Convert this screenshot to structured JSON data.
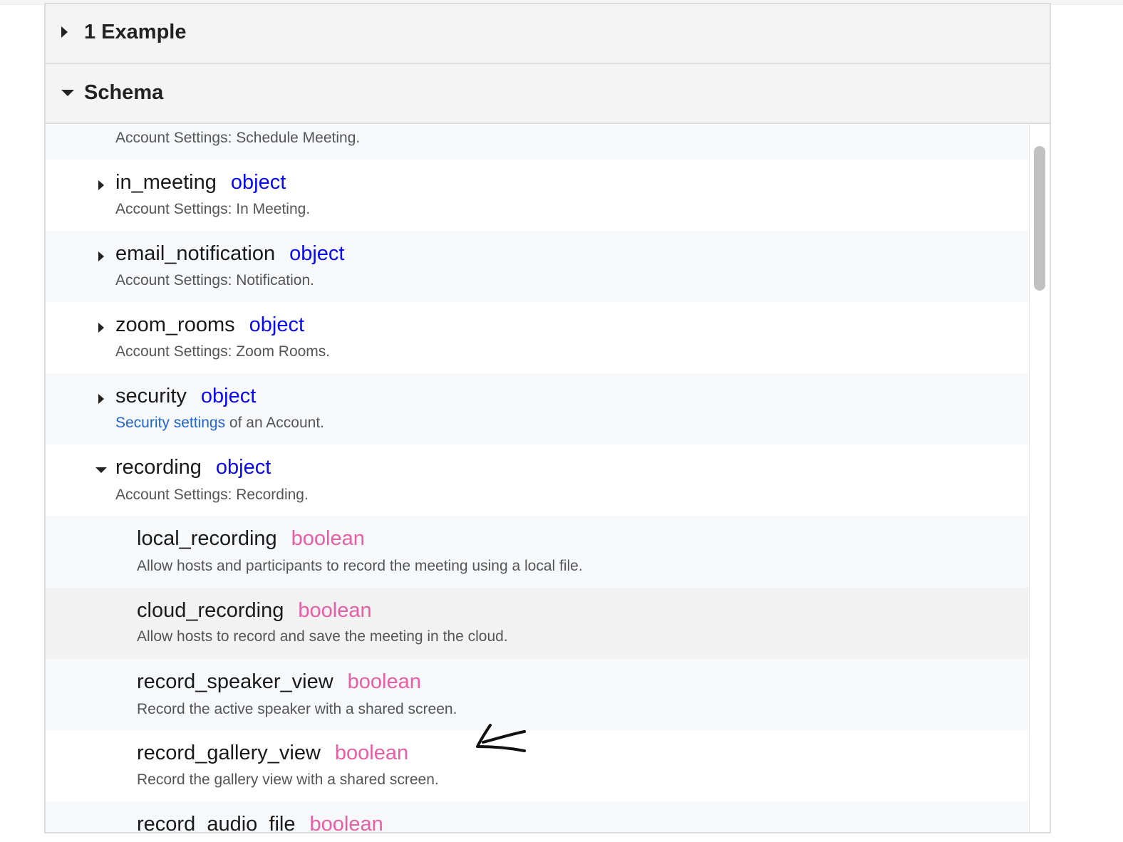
{
  "accordions": {
    "example": {
      "label": "1 Example",
      "expanded": false
    },
    "schema": {
      "label": "Schema",
      "expanded": true
    }
  },
  "schema": {
    "top_desc": "Account Settings: Schedule Meeting.",
    "properties": [
      {
        "name": "in_meeting",
        "type": "object",
        "desc": "Account Settings: In Meeting.",
        "expanded": false
      },
      {
        "name": "email_notification",
        "type": "object",
        "desc": "Account Settings: Notification.",
        "expanded": false
      },
      {
        "name": "zoom_rooms",
        "type": "object",
        "desc": "Account Settings: Zoom Rooms.",
        "expanded": false
      },
      {
        "name": "security",
        "type": "object",
        "desc_link": "Security settings",
        "desc_rest": " of an Account.",
        "expanded": false
      },
      {
        "name": "recording",
        "type": "object",
        "desc": "Account Settings: Recording.",
        "expanded": true
      }
    ],
    "recording_children": [
      {
        "name": "local_recording",
        "type": "boolean",
        "desc": "Allow hosts and participants to record the meeting using a local file."
      },
      {
        "name": "cloud_recording",
        "type": "boolean",
        "desc": "Allow hosts to record and save the meeting in the cloud."
      },
      {
        "name": "record_speaker_view",
        "type": "boolean",
        "desc": "Record the active speaker with a shared screen."
      },
      {
        "name": "record_gallery_view",
        "type": "boolean",
        "desc": "Record the gallery view with a shared screen."
      },
      {
        "name": "record_audio_file",
        "type": "boolean"
      }
    ]
  },
  "colors": {
    "object_type": "#0a0aee",
    "boolean_type": "#e75ea4",
    "link": "#2065d1"
  },
  "icons": [
    "caret-right-icon",
    "caret-down-icon",
    "hand-drawn-arrow-icon"
  ]
}
